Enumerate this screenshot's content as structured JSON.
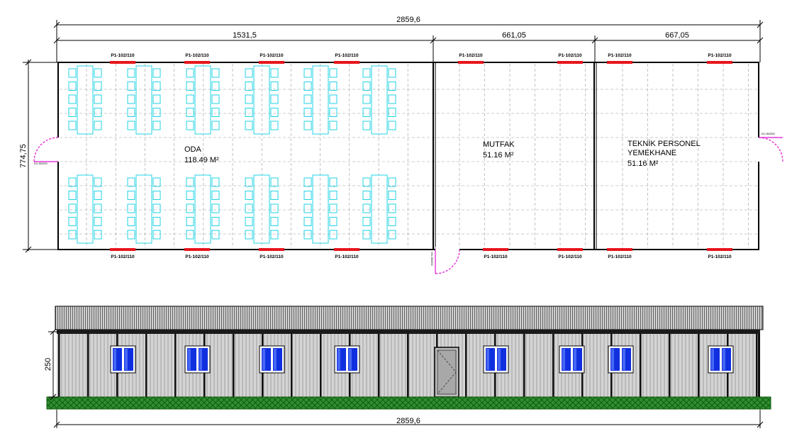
{
  "dimensions": {
    "total_width": "2859,6",
    "seg_1": "1531,5",
    "seg_2": "661,05",
    "seg_3": "667,05",
    "depth": "774,75",
    "elevation_height": "250",
    "elevation_width": "2859,6"
  },
  "window_code": "P1-102/110",
  "door_code": "D1-90/200",
  "rooms": [
    {
      "name": "ODA",
      "area": "118.49 M²"
    },
    {
      "name": "MUTFAK",
      "area": "51.16 M²"
    },
    {
      "name": "TEKNİK PERSONEL",
      "name2": "YEMEKHANE",
      "area": "51.16 M²"
    }
  ],
  "colors": {
    "furniture": "#22d3e6",
    "window_mark": "#e8141c",
    "door_swing": "#e10fd0",
    "grid": "#9a9a9a",
    "grass": "#1e7a1e",
    "glass": "#1030e0"
  }
}
